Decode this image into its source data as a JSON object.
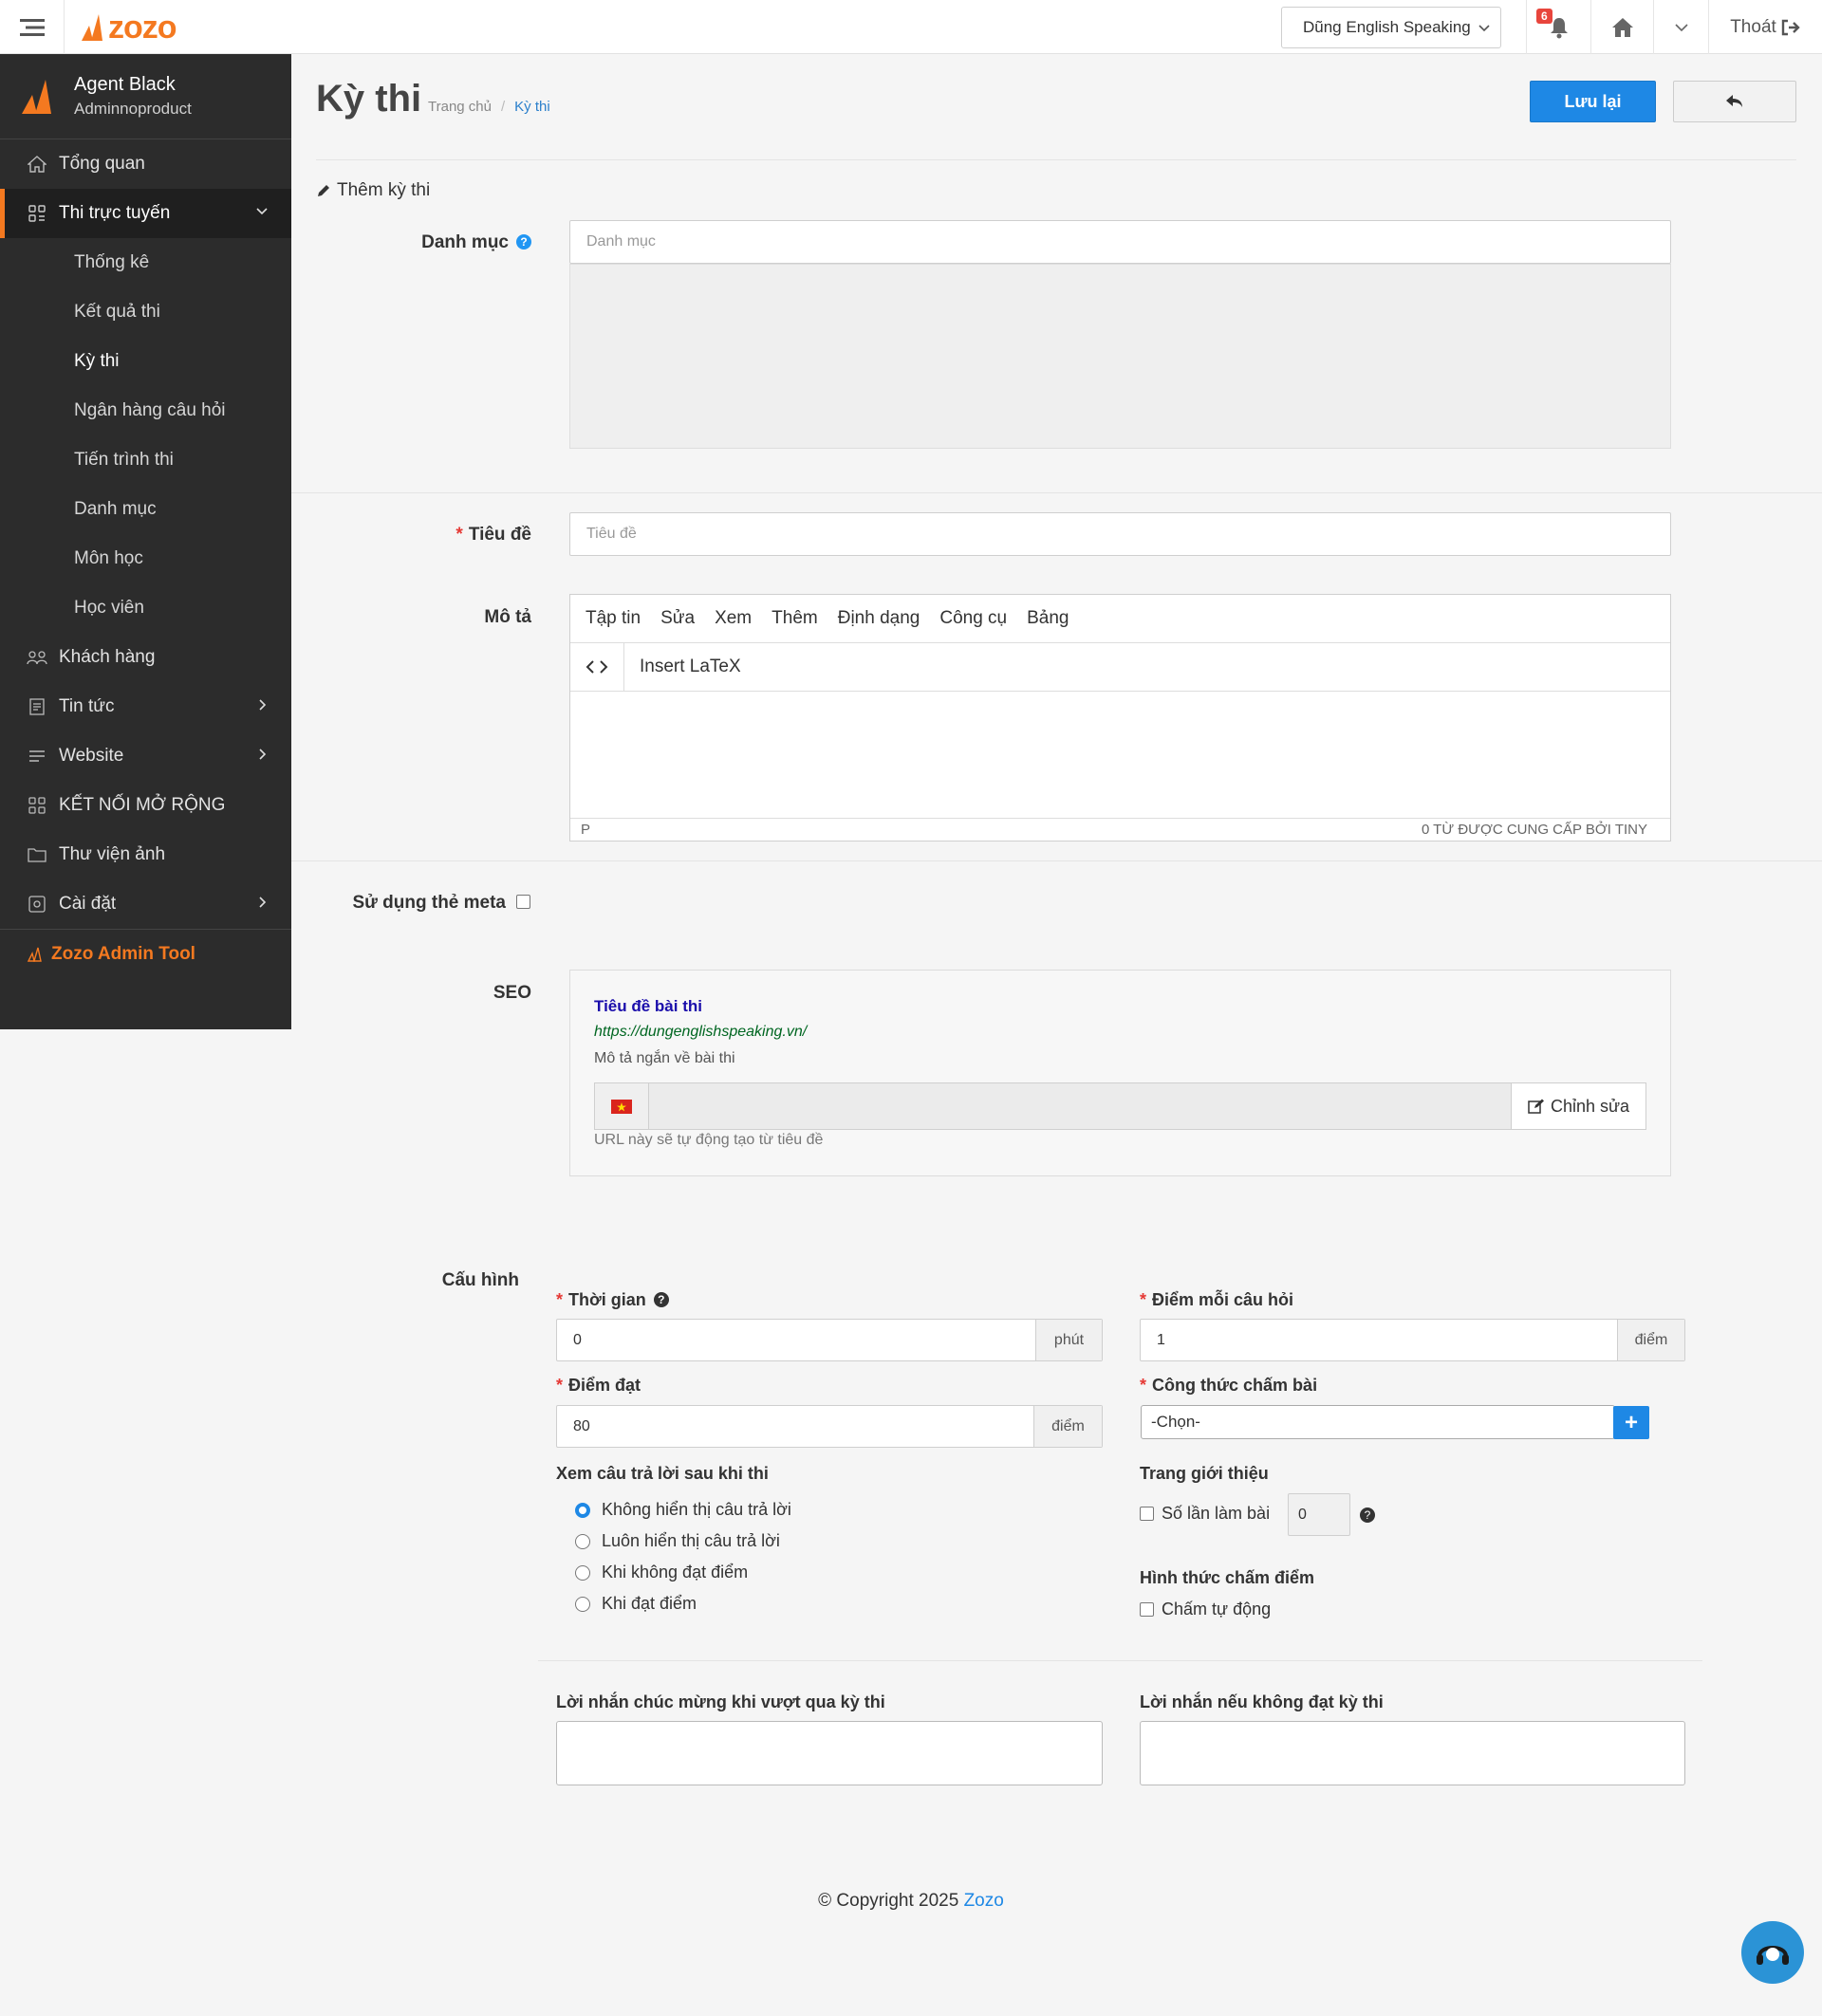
{
  "brand": {
    "logo_text": "zozo",
    "accent": "#f47920",
    "primary": "#1e88e5"
  },
  "topbar": {
    "site_selector": "Dũng English Speaking",
    "notifications_count": "6",
    "logout_label": "Thoát"
  },
  "sidebar": {
    "user_name": "Agent Black",
    "user_role": "Adminnoproduct",
    "items": [
      {
        "label": "Tổng quan",
        "icon": "home-icon"
      },
      {
        "label": "Thi trực tuyến",
        "icon": "grid-icon",
        "expanded": true
      },
      {
        "label": "Khách hàng",
        "icon": "users-icon"
      },
      {
        "label": "Tin tức",
        "icon": "news-icon"
      },
      {
        "label": "Website",
        "icon": "list-icon"
      },
      {
        "label": "KẾT NỐI MỞ RỘNG",
        "icon": "grid-icon"
      },
      {
        "label": "Thư viện ảnh",
        "icon": "folder-icon"
      },
      {
        "label": "Cài đặt",
        "icon": "settings-icon"
      }
    ],
    "subitems": [
      "Thống kê",
      "Kết quả thi",
      "Kỳ thi",
      "Ngân hàng câu hỏi",
      "Tiến trình thi",
      "Danh mục",
      "Môn học",
      "Học viên"
    ],
    "tool_label": "Zozo Admin Tool"
  },
  "page": {
    "title": "Kỳ thi",
    "breadcrumb": [
      "Trang chủ",
      "Kỳ thi"
    ],
    "save_label": "Lưu lại",
    "section_title": "Thêm kỳ thi"
  },
  "form": {
    "category_label": "Danh mục",
    "category_placeholder": "Danh mục",
    "title_label": "Tiêu đề",
    "title_placeholder": "Tiêu đề",
    "description_label": "Mô tả",
    "editor_menu": [
      "Tập tin",
      "Sửa",
      "Xem",
      "Thêm",
      "Định dạng",
      "Công cụ",
      "Bảng"
    ],
    "editor_latex": "Insert LaTeX",
    "editor_path": "P",
    "editor_status": "0 TỪ  ĐƯỢC CUNG CẤP BỞI TINY",
    "meta_label": "Sử dụng thẻ meta",
    "seo_label": "SEO",
    "seo": {
      "title": "Tiêu đề bài thi",
      "url": "https://dungenglishspeaking.vn/",
      "description": "Mô tả ngắn về bài thi",
      "edit_label": "Chỉnh sửa",
      "hint": "URL này sẽ tự động tạo từ tiêu đề"
    }
  },
  "config": {
    "label": "Cấu hình",
    "time_label": "Thời gian",
    "time_value": "0",
    "time_unit": "phút",
    "points_label": "Điểm mỗi câu hỏi",
    "points_value": "1",
    "points_unit": "điểm",
    "pass_label": "Điểm đạt",
    "pass_value": "80",
    "pass_unit": "điểm",
    "formula_label": "Công thức chấm bài",
    "formula_value": "-Chọn-",
    "review_label": "Xem câu trả lời sau khi thi",
    "review_options": [
      "Không hiển thị câu trả lời",
      "Luôn hiển thị câu trả lời",
      "Khi không đạt điểm",
      "Khi đạt điểm"
    ],
    "intro_label": "Trang giới thiệu",
    "attempts_label": "Số lần làm bài",
    "attempts_value": "0",
    "grading_label": "Hình thức chấm điểm",
    "auto_grade_label": "Chấm tự động",
    "pass_message_label": "Lời nhắn chúc mừng khi vượt qua kỳ thi",
    "fail_message_label": "Lời nhắn nếu không đạt kỳ thi"
  },
  "footer": {
    "text": "© Copyright 2025",
    "link": "Zozo"
  }
}
